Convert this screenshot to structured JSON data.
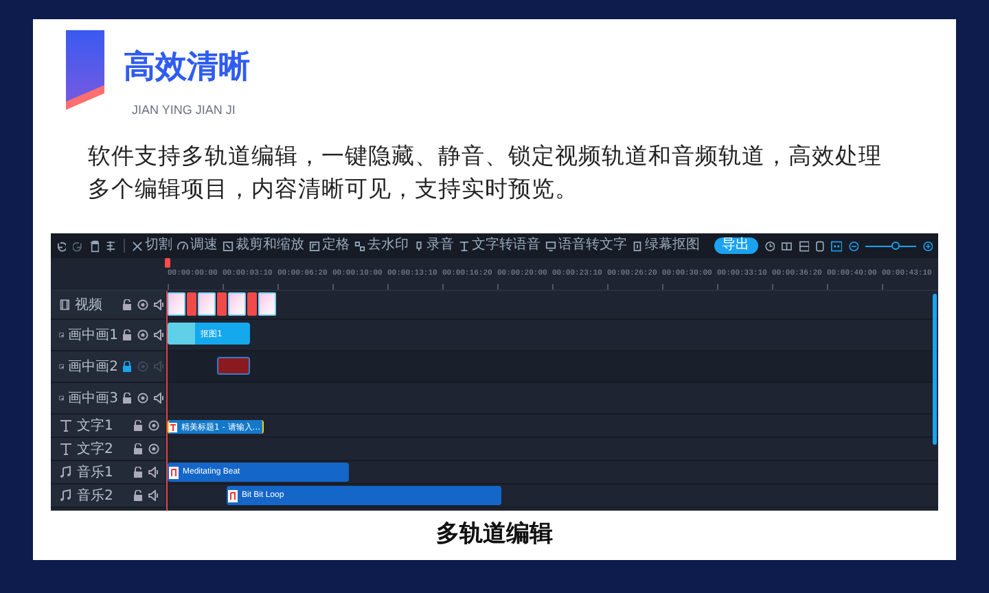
{
  "heading": {
    "title": "高效清晰",
    "subtitle": "JIAN YING JIAN JI"
  },
  "description": "软件支持多轨道编辑，一键隐藏、静音、锁定视频轨道和音频轨道，高效处理多个编辑项目，内容清晰可见，支持实时预览。",
  "editor": {
    "tools": [
      {
        "label": "切割"
      },
      {
        "label": "调速"
      },
      {
        "label": "裁剪和缩放"
      },
      {
        "label": "定格"
      },
      {
        "label": "去水印"
      },
      {
        "label": "录音"
      },
      {
        "label": "文字转语音"
      },
      {
        "label": "语音转文字"
      },
      {
        "label": "绿幕抠图"
      }
    ],
    "export_button": "导出",
    "zoom_slider": {
      "level": 0.6
    },
    "ruler": [
      "00:00:00:00",
      "00:00:03:10",
      "00:00:06:20",
      "00:00:10:00",
      "00:00:13:10",
      "00:00:16:20",
      "00:00:20:00",
      "00:00:23:10",
      "00:00:26:20",
      "00:00:30:00",
      "00:00:33:10",
      "00:00:36:20",
      "00:00:40:00",
      "00:00:43:10"
    ],
    "tracks": [
      {
        "name": "视频",
        "kind": "video",
        "locked": false,
        "clips": [
          {
            "kind": "thumbs"
          }
        ]
      },
      {
        "name": "画中画1",
        "kind": "pip",
        "locked": false,
        "clips": [
          {
            "kind": "media",
            "label": "抠图1"
          }
        ]
      },
      {
        "name": "画中画2",
        "kind": "pip",
        "locked": true,
        "clips": [
          {
            "kind": "image"
          }
        ]
      },
      {
        "name": "画中画3",
        "kind": "pip",
        "locked": false
      },
      {
        "name": "文字1",
        "kind": "text",
        "locked": false,
        "clips": [
          {
            "kind": "text",
            "label": "精美标题1 - 请输入..."
          }
        ]
      },
      {
        "name": "文字2",
        "kind": "text",
        "locked": false
      },
      {
        "name": "音乐1",
        "kind": "audio",
        "locked": false,
        "clips": [
          {
            "kind": "audio",
            "label": "Meditating Beat"
          }
        ]
      },
      {
        "name": "音乐2",
        "kind": "audio",
        "locked": false,
        "clips": [
          {
            "kind": "audio",
            "label": "Bit Bit Loop"
          }
        ]
      }
    ]
  },
  "caption": "多轨道编辑"
}
